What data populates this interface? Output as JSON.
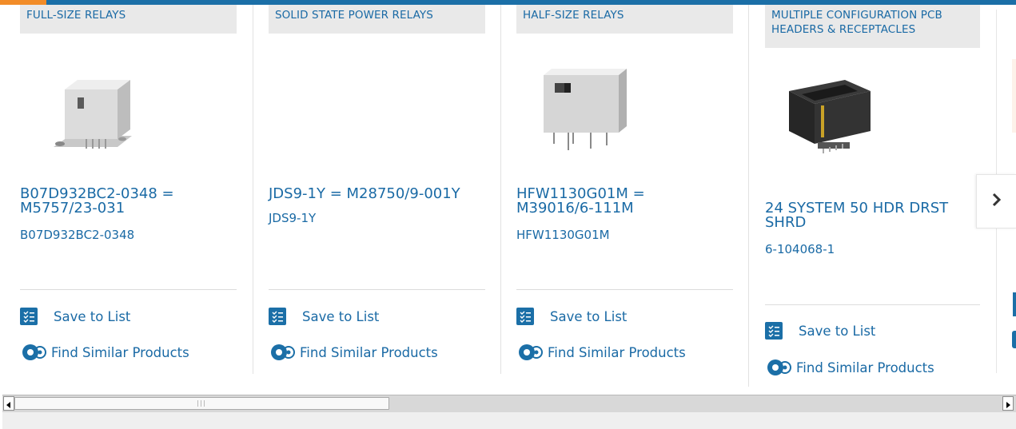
{
  "cards": [
    {
      "category": "FULL-SIZE RELAYS",
      "title": "B07D932BC2-0348 = M5757/23-031",
      "part_number": "B07D932BC2-0348",
      "save_label": "Save to List",
      "similar_label": "Find Similar Products"
    },
    {
      "category": "SOLID STATE POWER RELAYS",
      "title": "JDS9-1Y = M28750/9-001Y",
      "part_number": "JDS9-1Y",
      "save_label": "Save to List",
      "similar_label": "Find Similar Products"
    },
    {
      "category": "HALF-SIZE RELAYS",
      "title": "HFW1130G01M = M39016/6-111M",
      "part_number": "HFW1130G01M",
      "save_label": "Save to List",
      "similar_label": "Find Similar Products"
    },
    {
      "category": "MULTIPLE CONFIGURATION PCB HEADERS & RECEPTACLES",
      "title": "24 SYSTEM 50 HDR DRST SHRD",
      "part_number": "6-104068-1",
      "save_label": "Save to List",
      "similar_label": "Find Similar Products"
    }
  ],
  "icons": {
    "save": "save-to-list-icon",
    "similar": "find-similar-icon",
    "next": "chevron-right-icon"
  },
  "colors": {
    "brand_blue": "#1a6aa5",
    "accent_orange": "#f28c28",
    "category_bg": "#e9e9e9"
  }
}
